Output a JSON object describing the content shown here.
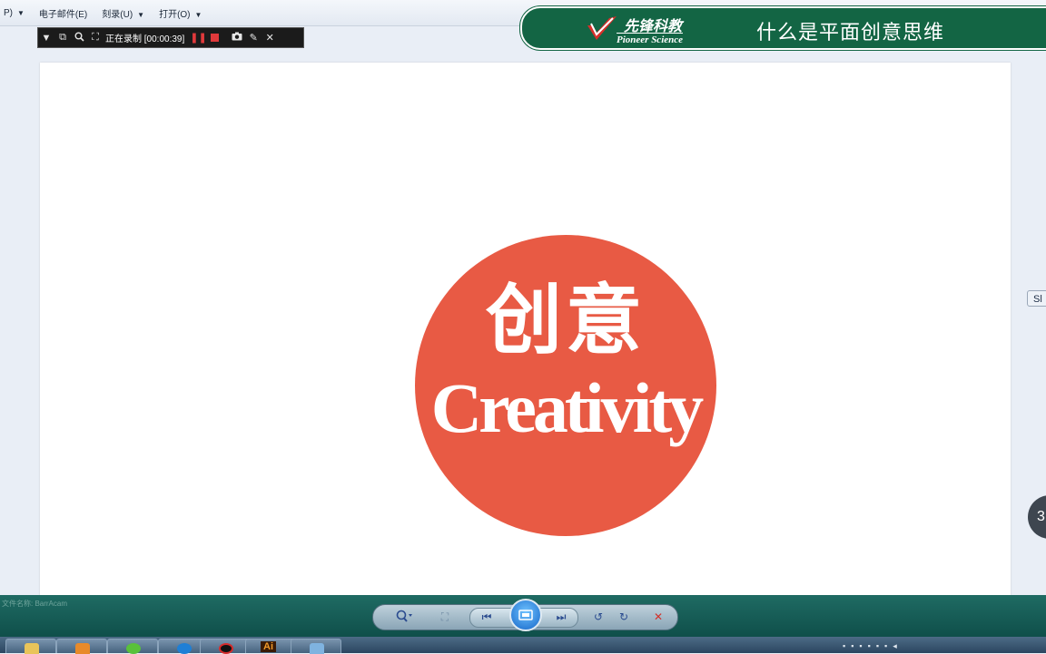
{
  "menu": {
    "items": [
      {
        "label": "P)",
        "has_caret": true
      },
      {
        "label": "电子邮件(E)",
        "has_caret": false
      },
      {
        "label": "刻录(U)",
        "has_caret": true
      },
      {
        "label": "打开(O)",
        "has_caret": true
      }
    ]
  },
  "recorder": {
    "status": "正在录制 [00:00:39]"
  },
  "brand": {
    "logo_cn": "先锋科教",
    "logo_en": "Pioneer Science",
    "title": "什么是平面创意思维",
    "color": "#136544"
  },
  "slide": {
    "cn_text": "创意",
    "en_text": "Creativity",
    "circle_color": "#e85a44"
  },
  "side": {
    "button_label": "Sl",
    "circle_label": "3"
  },
  "statusbar": {
    "text": "文件名称: BarrAcam"
  },
  "taskbar": {
    "app_label": "Ai"
  }
}
